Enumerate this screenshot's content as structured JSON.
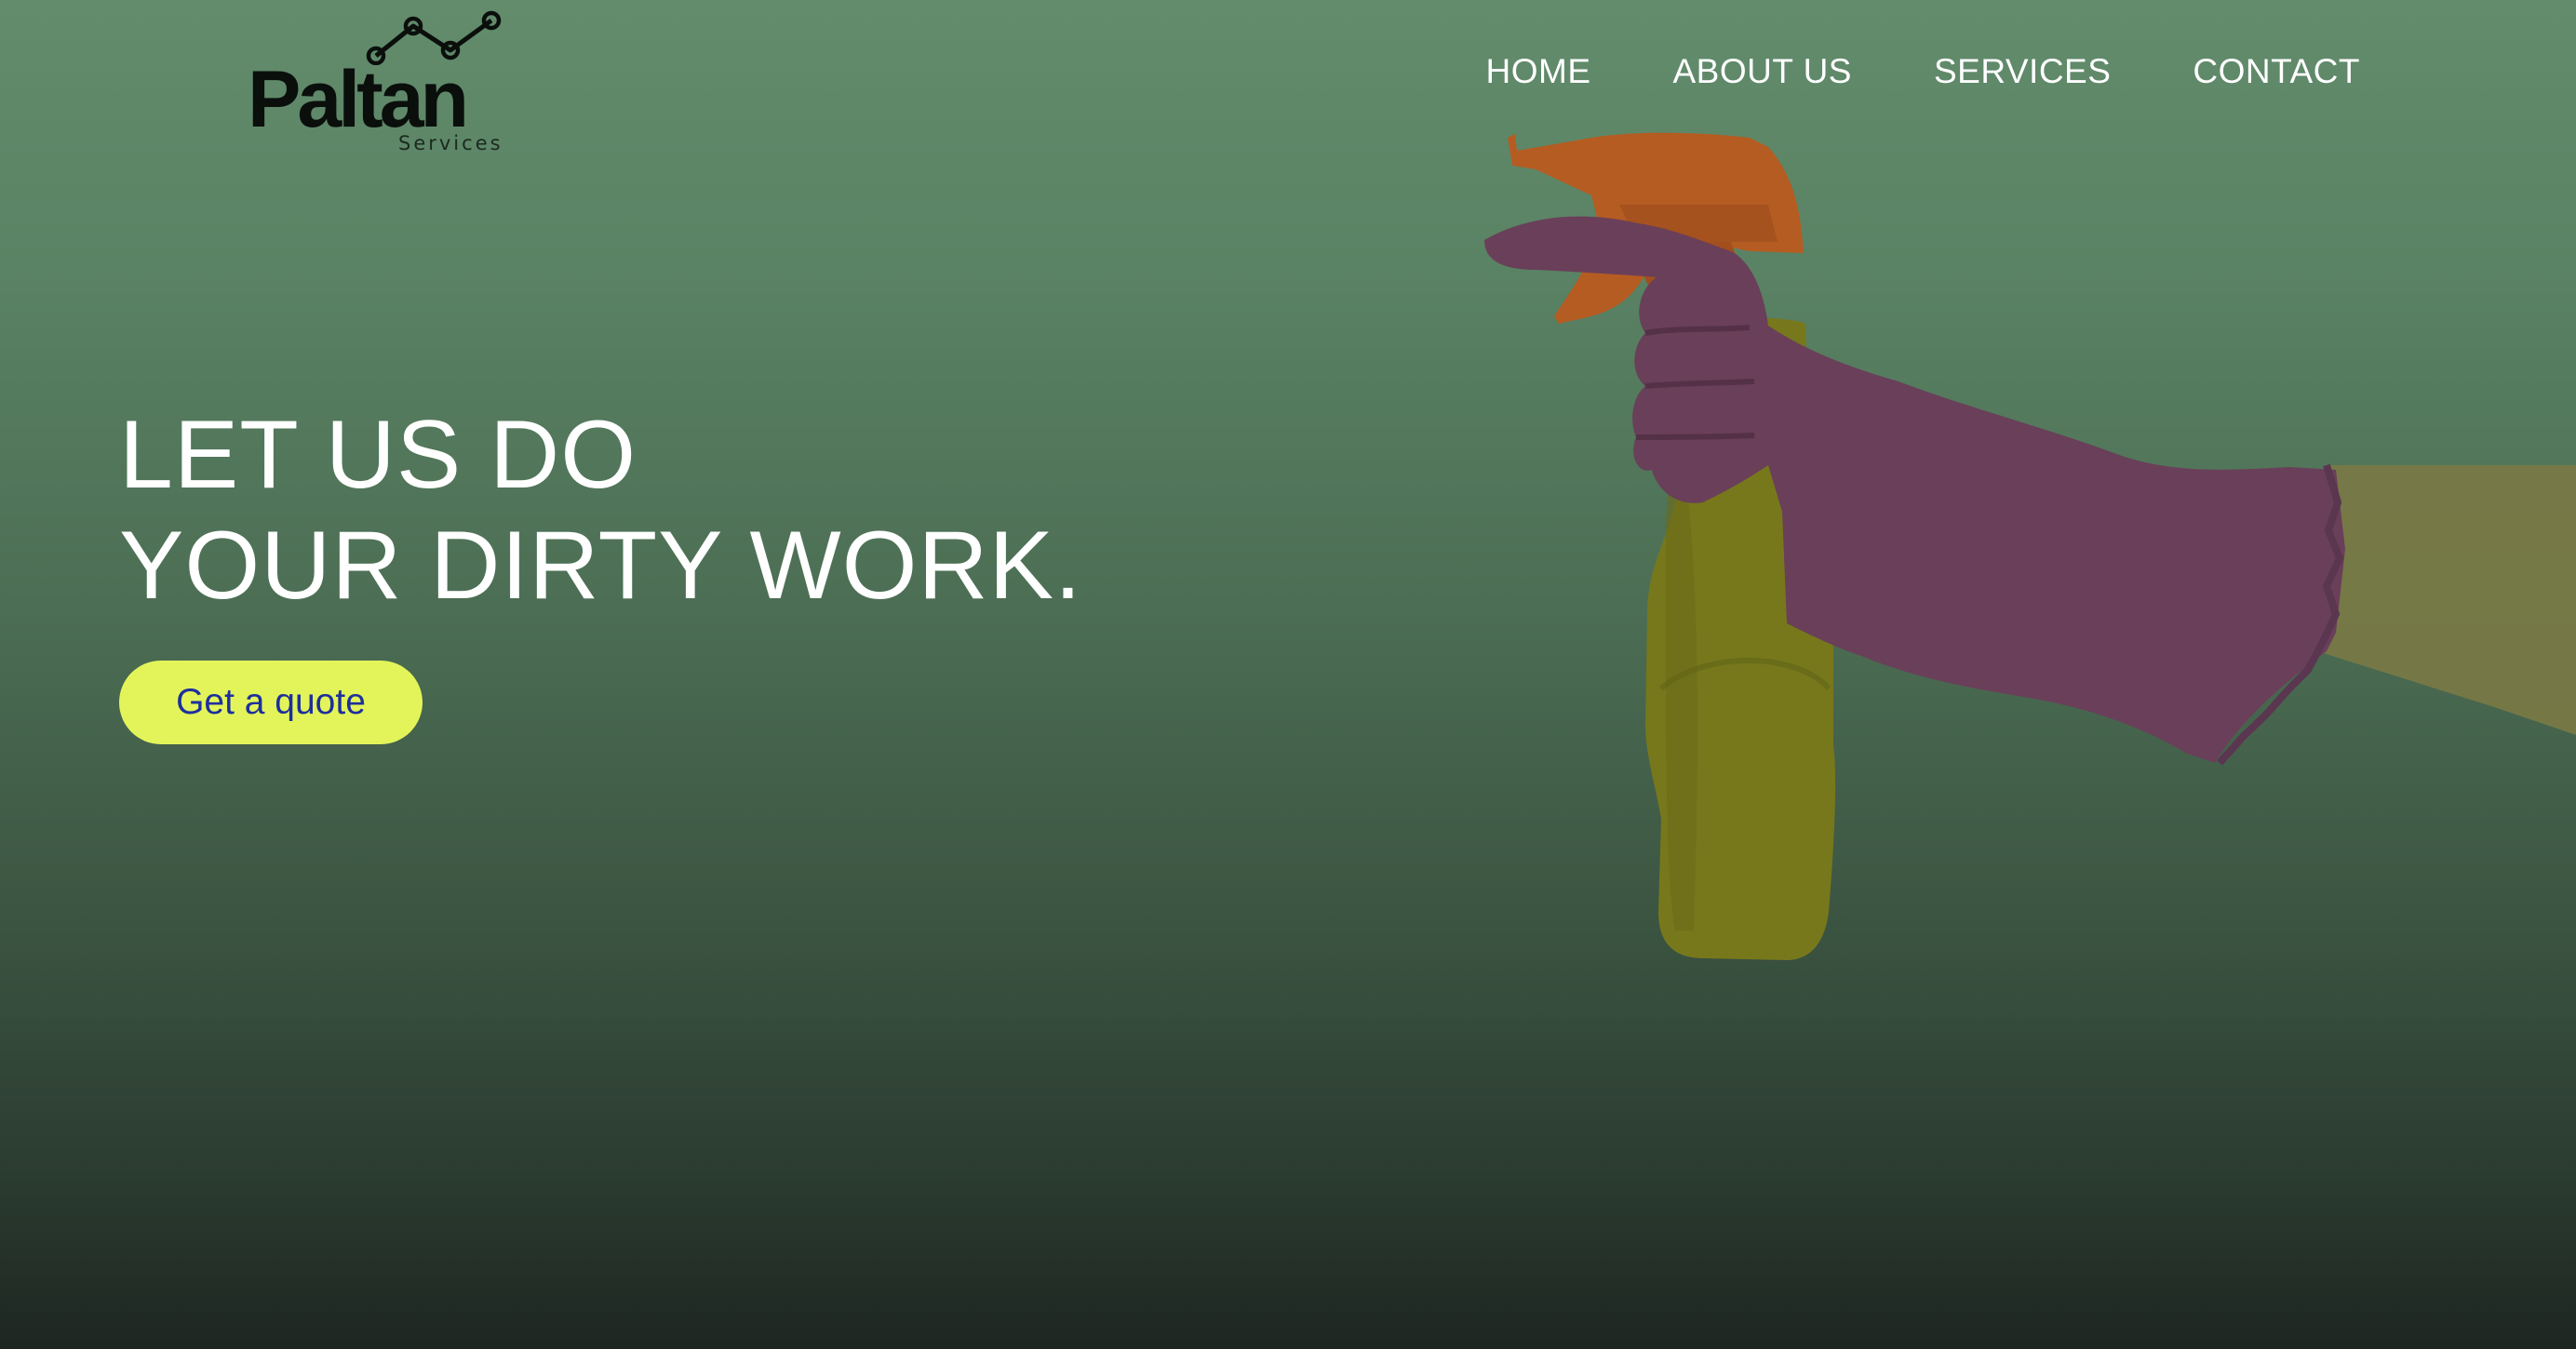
{
  "brand": {
    "name": "Paltan",
    "tagline": "Services"
  },
  "nav": {
    "items": [
      {
        "label": "HOME"
      },
      {
        "label": "ABOUT US"
      },
      {
        "label": "SERVICES"
      },
      {
        "label": "CONTACT"
      }
    ]
  },
  "hero": {
    "headline_line1": "LET US DO",
    "headline_line2": "YOUR DIRTY WORK.",
    "cta_label": "Get a quote"
  },
  "colors": {
    "cta_background": "#e3f45a",
    "cta_text": "#1d2f9c",
    "background_top": "#628c6c",
    "background_bottom": "#1e2622"
  },
  "icons": {
    "logo_mark": "trend-line-icon",
    "hero_image": "spray-bottle-glove-illustration"
  }
}
